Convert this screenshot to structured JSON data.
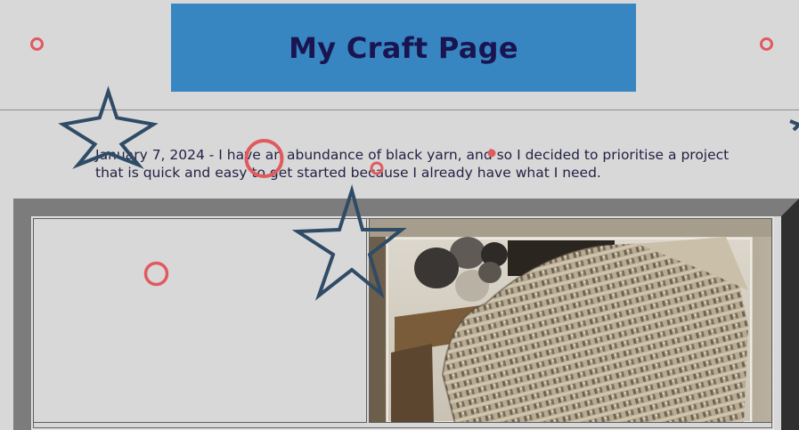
{
  "header": {
    "title": "My Craft Page",
    "banner_color": "#3786c2",
    "title_color": "#1a1550"
  },
  "entry": {
    "text": "January 7, 2024 - I have an abundance of black yarn, and so I decided to prioritise a project that is quick and easy to get started because I already have what I need."
  },
  "gallery": {
    "photo_subject": "crochet-blanket-with-yarn-balls"
  },
  "decorations": {
    "star_color": "#2f4b66",
    "ring_color": "#e05a5e",
    "icons": [
      "star-icon",
      "ring-icon"
    ]
  }
}
